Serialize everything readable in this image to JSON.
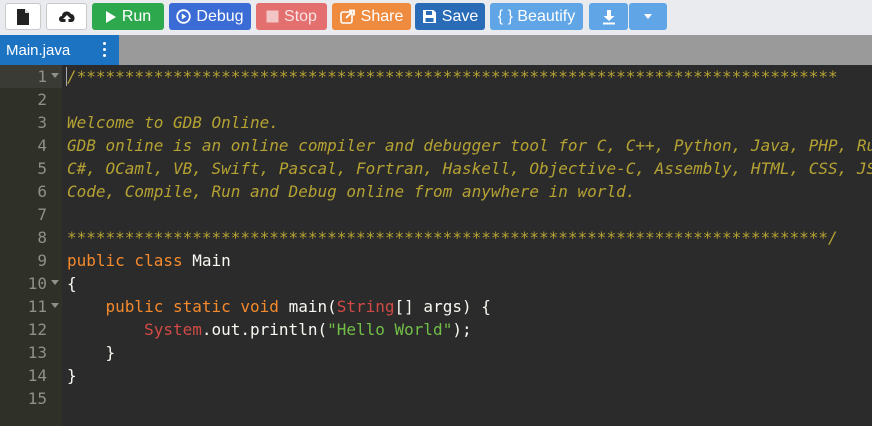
{
  "toolbar": {
    "buttons": [
      {
        "id": "new",
        "icon": "new-file-icon"
      },
      {
        "id": "upload",
        "icon": "upload-cloud-icon"
      },
      {
        "id": "run",
        "label": "Run",
        "icon": "play-icon",
        "color": "#2ea84d"
      },
      {
        "id": "debug",
        "label": "Debug",
        "icon": "debug-circle-icon",
        "color": "#3b6bd5"
      },
      {
        "id": "stop",
        "label": "Stop",
        "icon": "stop-square-icon",
        "color": "#e45a5a"
      },
      {
        "id": "share",
        "label": "Share",
        "icon": "share-icon",
        "color": "#ee8b3f"
      },
      {
        "id": "save",
        "label": "Save",
        "icon": "floppy-disk-icon",
        "color": "#2a6bb8"
      },
      {
        "id": "beautify",
        "label": "{ } Beautify",
        "color": "#60a5e5"
      },
      {
        "id": "download",
        "icon": "download-icon",
        "color": "#60a5e5"
      },
      {
        "id": "download_menu",
        "icon": "caret-down-icon",
        "color": "#60a5e5"
      }
    ]
  },
  "tabs": [
    {
      "label": "Main.java",
      "active": true
    }
  ],
  "editor": {
    "gutter_lines": [
      "1",
      "2",
      "3",
      "4",
      "5",
      "6",
      "7",
      "8",
      "9",
      "10",
      "11",
      "12",
      "13",
      "14",
      "15"
    ],
    "fold_lines": [
      "1",
      "10",
      "11"
    ],
    "active_line": "1",
    "lines": [
      [
        {
          "t": "cmt",
          "v": "/*******************************************************************************"
        }
      ],
      [],
      [
        {
          "t": "cmt",
          "v": "Welcome to GDB Online."
        }
      ],
      [
        {
          "t": "cmt",
          "v": "GDB online is an online compiler and debugger tool for C, C++, Python, Java, PHP, Ruby, Perl,"
        }
      ],
      [
        {
          "t": "cmt",
          "v": "C#, OCaml, VB, Swift, Pascal, Fortran, Haskell, Objective-C, Assembly, HTML, CSS, JS, SQLite, Prolog."
        }
      ],
      [
        {
          "t": "cmt",
          "v": "Code, Compile, Run and Debug online from anywhere in world."
        }
      ],
      [],
      [
        {
          "t": "cmt",
          "v": "*******************************************************************************/"
        }
      ],
      [
        {
          "t": "kw",
          "v": "public class "
        },
        {
          "t": "plain",
          "v": "Main"
        }
      ],
      [
        {
          "t": "plain",
          "v": "{"
        }
      ],
      [
        {
          "t": "plain",
          "v": "    "
        },
        {
          "t": "kw",
          "v": "public static void "
        },
        {
          "t": "plain",
          "v": "main("
        },
        {
          "t": "type",
          "v": "String"
        },
        {
          "t": "plain",
          "v": "[] args) {"
        }
      ],
      [
        {
          "t": "plain",
          "v": "        "
        },
        {
          "t": "type",
          "v": "System"
        },
        {
          "t": "plain",
          "v": ".out.println("
        },
        {
          "t": "str",
          "v": "\"Hello World\""
        },
        {
          "t": "plain",
          "v": ");"
        }
      ],
      [
        {
          "t": "plain",
          "v": "    }"
        }
      ],
      [
        {
          "t": "plain",
          "v": "}"
        }
      ],
      []
    ]
  }
}
